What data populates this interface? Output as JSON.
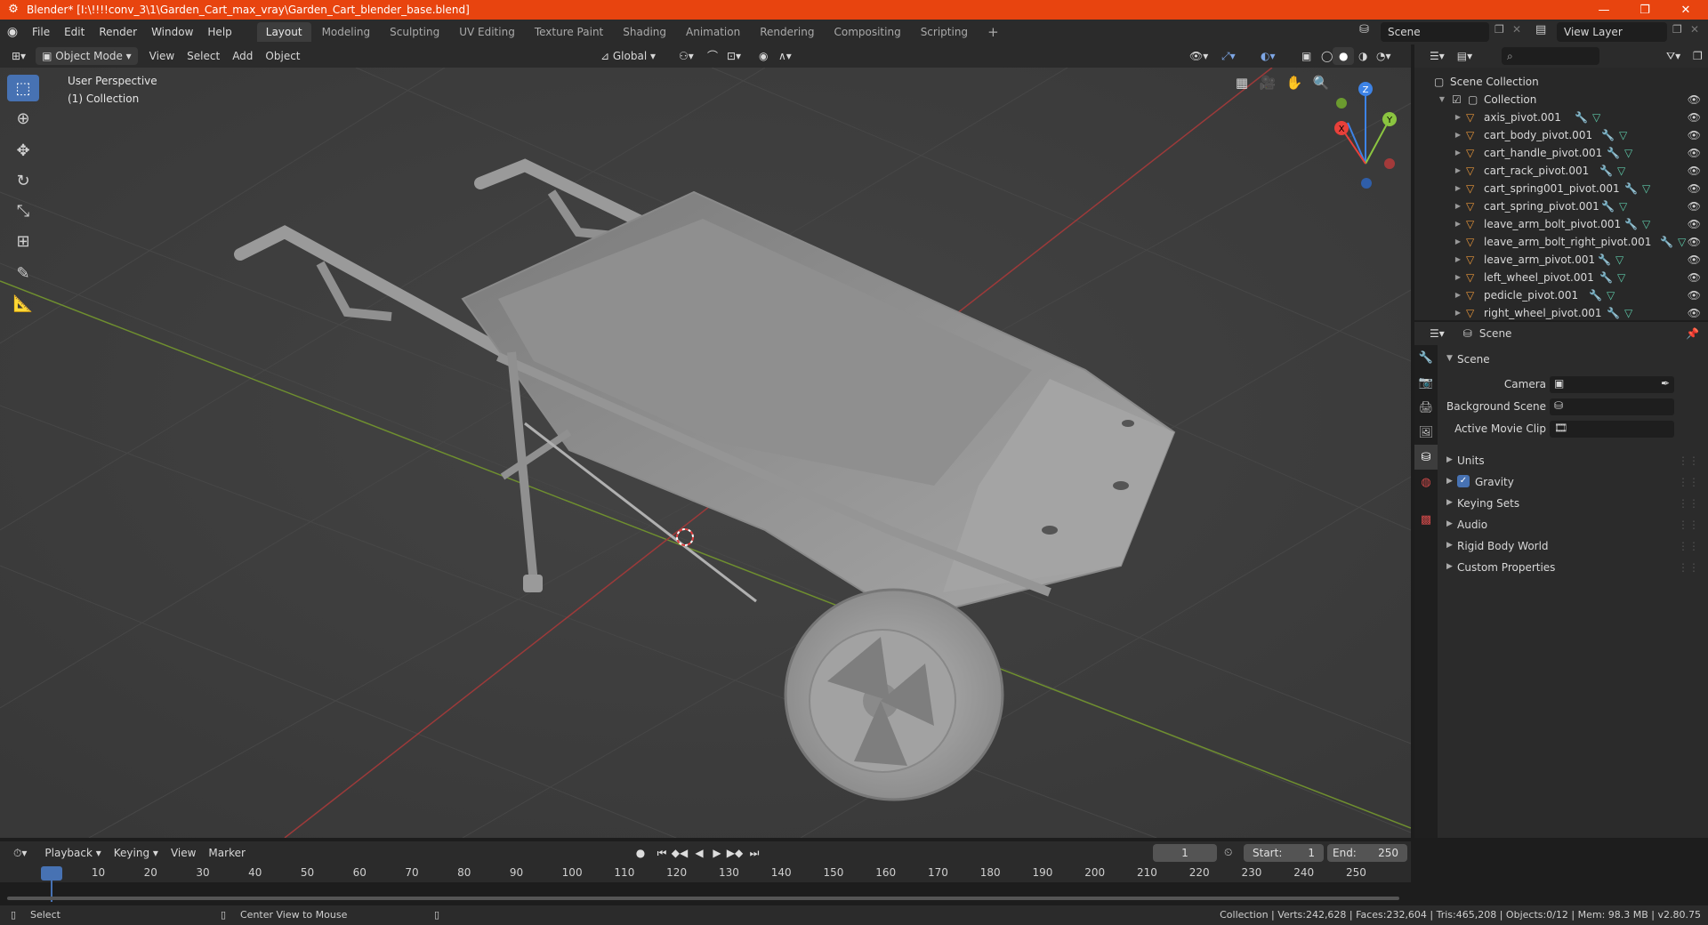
{
  "window": {
    "title": "Blender* [I:\\!!!!conv_3\\1\\Garden_Cart_max_vray\\Garden_Cart_blender_base.blend]",
    "minimize": "—",
    "maximize": "❐",
    "close": "✕"
  },
  "menu": [
    "File",
    "Edit",
    "Render",
    "Window",
    "Help"
  ],
  "workspaces": [
    "Layout",
    "Modeling",
    "Sculpting",
    "UV Editing",
    "Texture Paint",
    "Shading",
    "Animation",
    "Rendering",
    "Compositing",
    "Scripting"
  ],
  "active_workspace": "Layout",
  "workspace_add": "+",
  "scene_name": "Scene",
  "view_layer": "View Layer",
  "viewport_header": {
    "mode": "Object Mode",
    "menus": [
      "View",
      "Select",
      "Add",
      "Object"
    ],
    "transform": "Global"
  },
  "viewport": {
    "perspective": "User Perspective",
    "collection": "(1) Collection",
    "gizmo_axes": {
      "x": "X",
      "y": "Y",
      "z": "Z"
    }
  },
  "outliner": {
    "root": "Scene Collection",
    "collection": "Collection",
    "objects": [
      "axis_pivot.001",
      "cart_body_pivot.001",
      "cart_handle_pivot.001",
      "cart_rack_pivot.001",
      "cart_spring001_pivot.001",
      "cart_spring_pivot.001",
      "leave_arm_bolt_pivot.001",
      "leave_arm_bolt_right_pivot.001",
      "leave_arm_pivot.001",
      "left_wheel_pivot.001",
      "pedicle_pivot.001",
      "right_wheel_pivot.001"
    ]
  },
  "properties": {
    "context": "Scene",
    "panel_title": "Scene",
    "fields": [
      {
        "label": "Camera"
      },
      {
        "label": "Background Scene"
      },
      {
        "label": "Active Movie Clip"
      }
    ],
    "sections": [
      "Units",
      "Gravity",
      "Keying Sets",
      "Audio",
      "Rigid Body World",
      "Custom Properties"
    ],
    "gravity_checked": true
  },
  "timeline": {
    "menus": [
      "Playback",
      "Keying",
      "View",
      "Marker"
    ],
    "current_frame": "1",
    "start_label": "Start:",
    "start": "1",
    "end_label": "End:",
    "end": "250",
    "ticks": [
      "1",
      "10",
      "20",
      "30",
      "40",
      "50",
      "60",
      "70",
      "80",
      "90",
      "100",
      "110",
      "120",
      "130",
      "140",
      "150",
      "160",
      "170",
      "180",
      "190",
      "200",
      "210",
      "220",
      "230",
      "240",
      "250"
    ]
  },
  "status": {
    "left": "Select",
    "middle": "Center View to Mouse",
    "stats": "Collection | Verts:242,628 | Faces:232,604 | Tris:465,208 | Objects:0/12 | Mem: 98.3 MB | v2.80.75"
  },
  "colors": {
    "titlebar": "#e8440f",
    "accent": "#4772b3",
    "x_axis": "#e8403a",
    "y_axis": "#8bc540",
    "z_axis": "#3d83e6"
  }
}
